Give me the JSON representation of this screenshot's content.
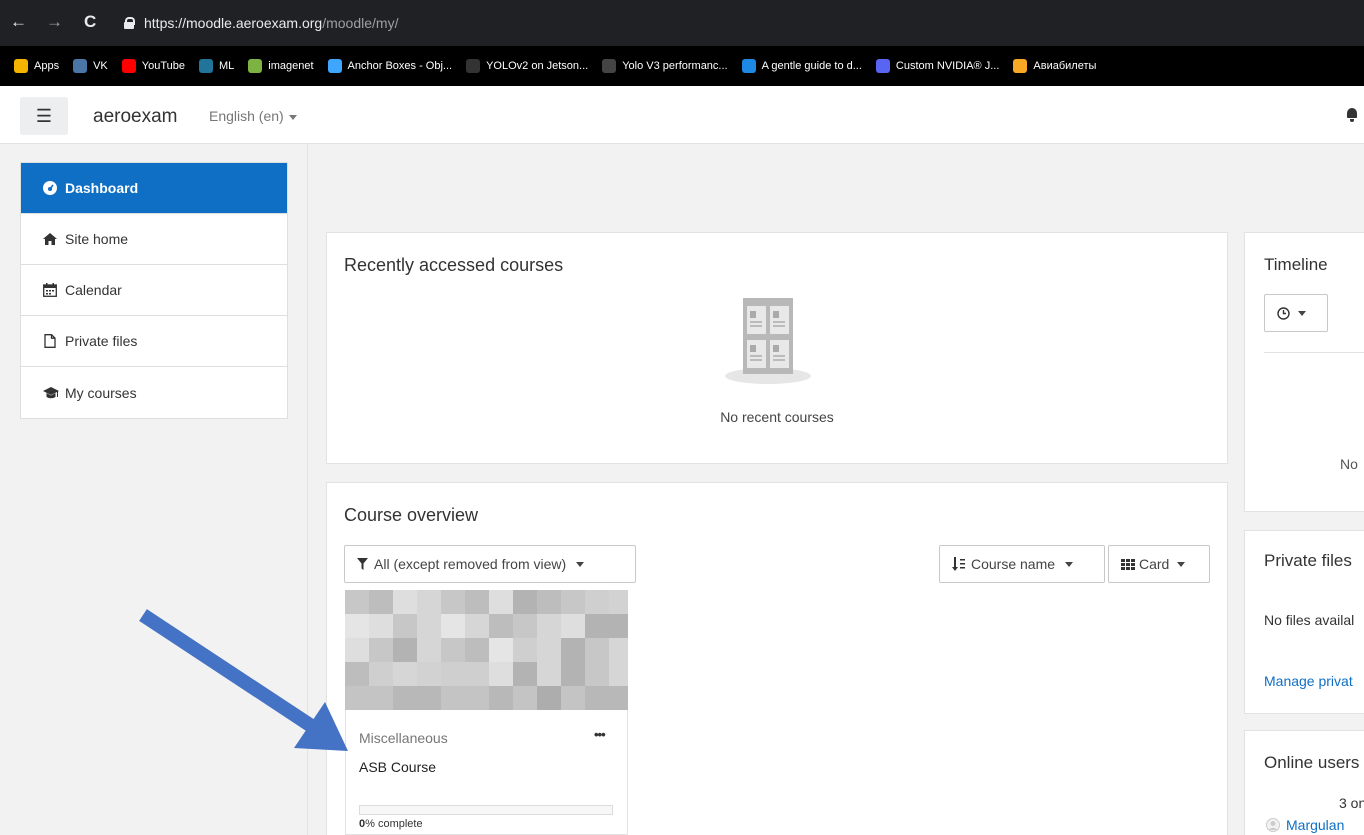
{
  "browser": {
    "url_host": "https://moodle.aeroexam.org",
    "url_path": "/moodle/my/",
    "bookmarks": [
      {
        "label": "Apps",
        "icon": "apps-grid-icon",
        "color": "#f4b400"
      },
      {
        "label": "VK",
        "icon": "vk-icon",
        "color": "#4a76a8"
      },
      {
        "label": "YouTube",
        "icon": "youtube-icon",
        "color": "#ff0000"
      },
      {
        "label": "ML",
        "icon": "wordpress-icon",
        "color": "#21759b"
      },
      {
        "label": "imagenet",
        "icon": "imagenet-icon",
        "color": "#7cb342"
      },
      {
        "label": "Anchor Boxes - Obj...",
        "icon": "infinity-icon",
        "color": "#3ea6ff"
      },
      {
        "label": "YOLOv2 on Jetson...",
        "icon": "github-icon",
        "color": "#333333"
      },
      {
        "label": "Yolo V3 performanc...",
        "icon": "blank-page-icon",
        "color": "#444444"
      },
      {
        "label": "A gentle guide to d...",
        "icon": "p-icon",
        "color": "#1e88e5"
      },
      {
        "label": "Custom NVIDIA® J...",
        "icon": "discord-icon",
        "color": "#5865f2"
      },
      {
        "label": "Авиабилеты",
        "icon": "plane-icon",
        "color": "#f9a825"
      }
    ]
  },
  "header": {
    "brand": "aeroexam",
    "language": "English (en)"
  },
  "nav": {
    "items": [
      {
        "label": "Dashboard",
        "icon": "dashboard-icon",
        "active": true
      },
      {
        "label": "Site home",
        "icon": "home-icon"
      },
      {
        "label": "Calendar",
        "icon": "calendar-icon"
      },
      {
        "label": "Private files",
        "icon": "file-icon"
      },
      {
        "label": "My courses",
        "icon": "graduation-cap-icon"
      }
    ]
  },
  "recent": {
    "title": "Recently accessed courses",
    "empty_text": "No recent courses"
  },
  "overview": {
    "title": "Course overview",
    "filter_label": "All (except removed from view)",
    "sort_label": "Course name",
    "view_label": "Card",
    "course": {
      "category": "Miscellaneous",
      "name": "ASB Course",
      "progress_percent": 0,
      "progress_value": "0",
      "progress_suffix": "% complete"
    }
  },
  "right": {
    "timeline_title": "Timeline",
    "timeline_empty": "No",
    "private_title": "Private files",
    "private_empty": "No files availal",
    "private_link": "Manage privat",
    "online_title": "Online users",
    "online_count": "3 on",
    "online_user": "Margulan"
  },
  "colors": {
    "accent": "#0f6fc5",
    "arrow": "#4472c4"
  }
}
